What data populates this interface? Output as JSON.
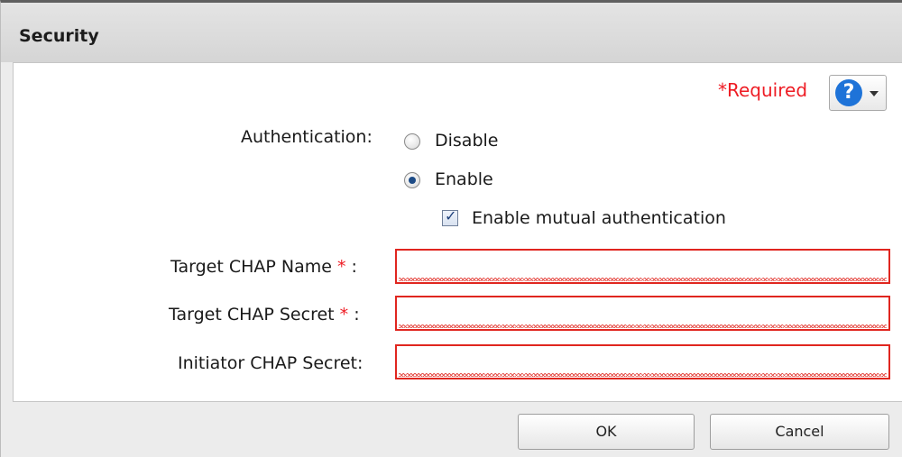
{
  "dialog": {
    "title": "Security",
    "required_note": "*Required",
    "help_symbol": "?"
  },
  "form": {
    "authentication_label": "Authentication:",
    "options": [
      {
        "label": "Disable",
        "selected": false
      },
      {
        "label": "Enable",
        "selected": true
      }
    ],
    "mutual_auth": {
      "label": "Enable mutual authentication",
      "checked": true
    },
    "fields": [
      {
        "label": "Target CHAP Name",
        "required": true,
        "suffix": " :",
        "value": ""
      },
      {
        "label": "Target CHAP Secret",
        "required": true,
        "suffix": " :",
        "value": ""
      },
      {
        "label": "Initiator CHAP Secret:",
        "required": false,
        "suffix": "",
        "value": ""
      }
    ],
    "required_marker": "*"
  },
  "buttons": {
    "ok": "OK",
    "cancel": "Cancel"
  },
  "colors": {
    "required_red": "#ee1c24",
    "field_error_border": "#e0261f",
    "help_blue": "#1e73d8"
  },
  "icons": {
    "help": "question-circle-icon",
    "dropdown": "caret-down-icon",
    "check": "checkmark-icon"
  }
}
